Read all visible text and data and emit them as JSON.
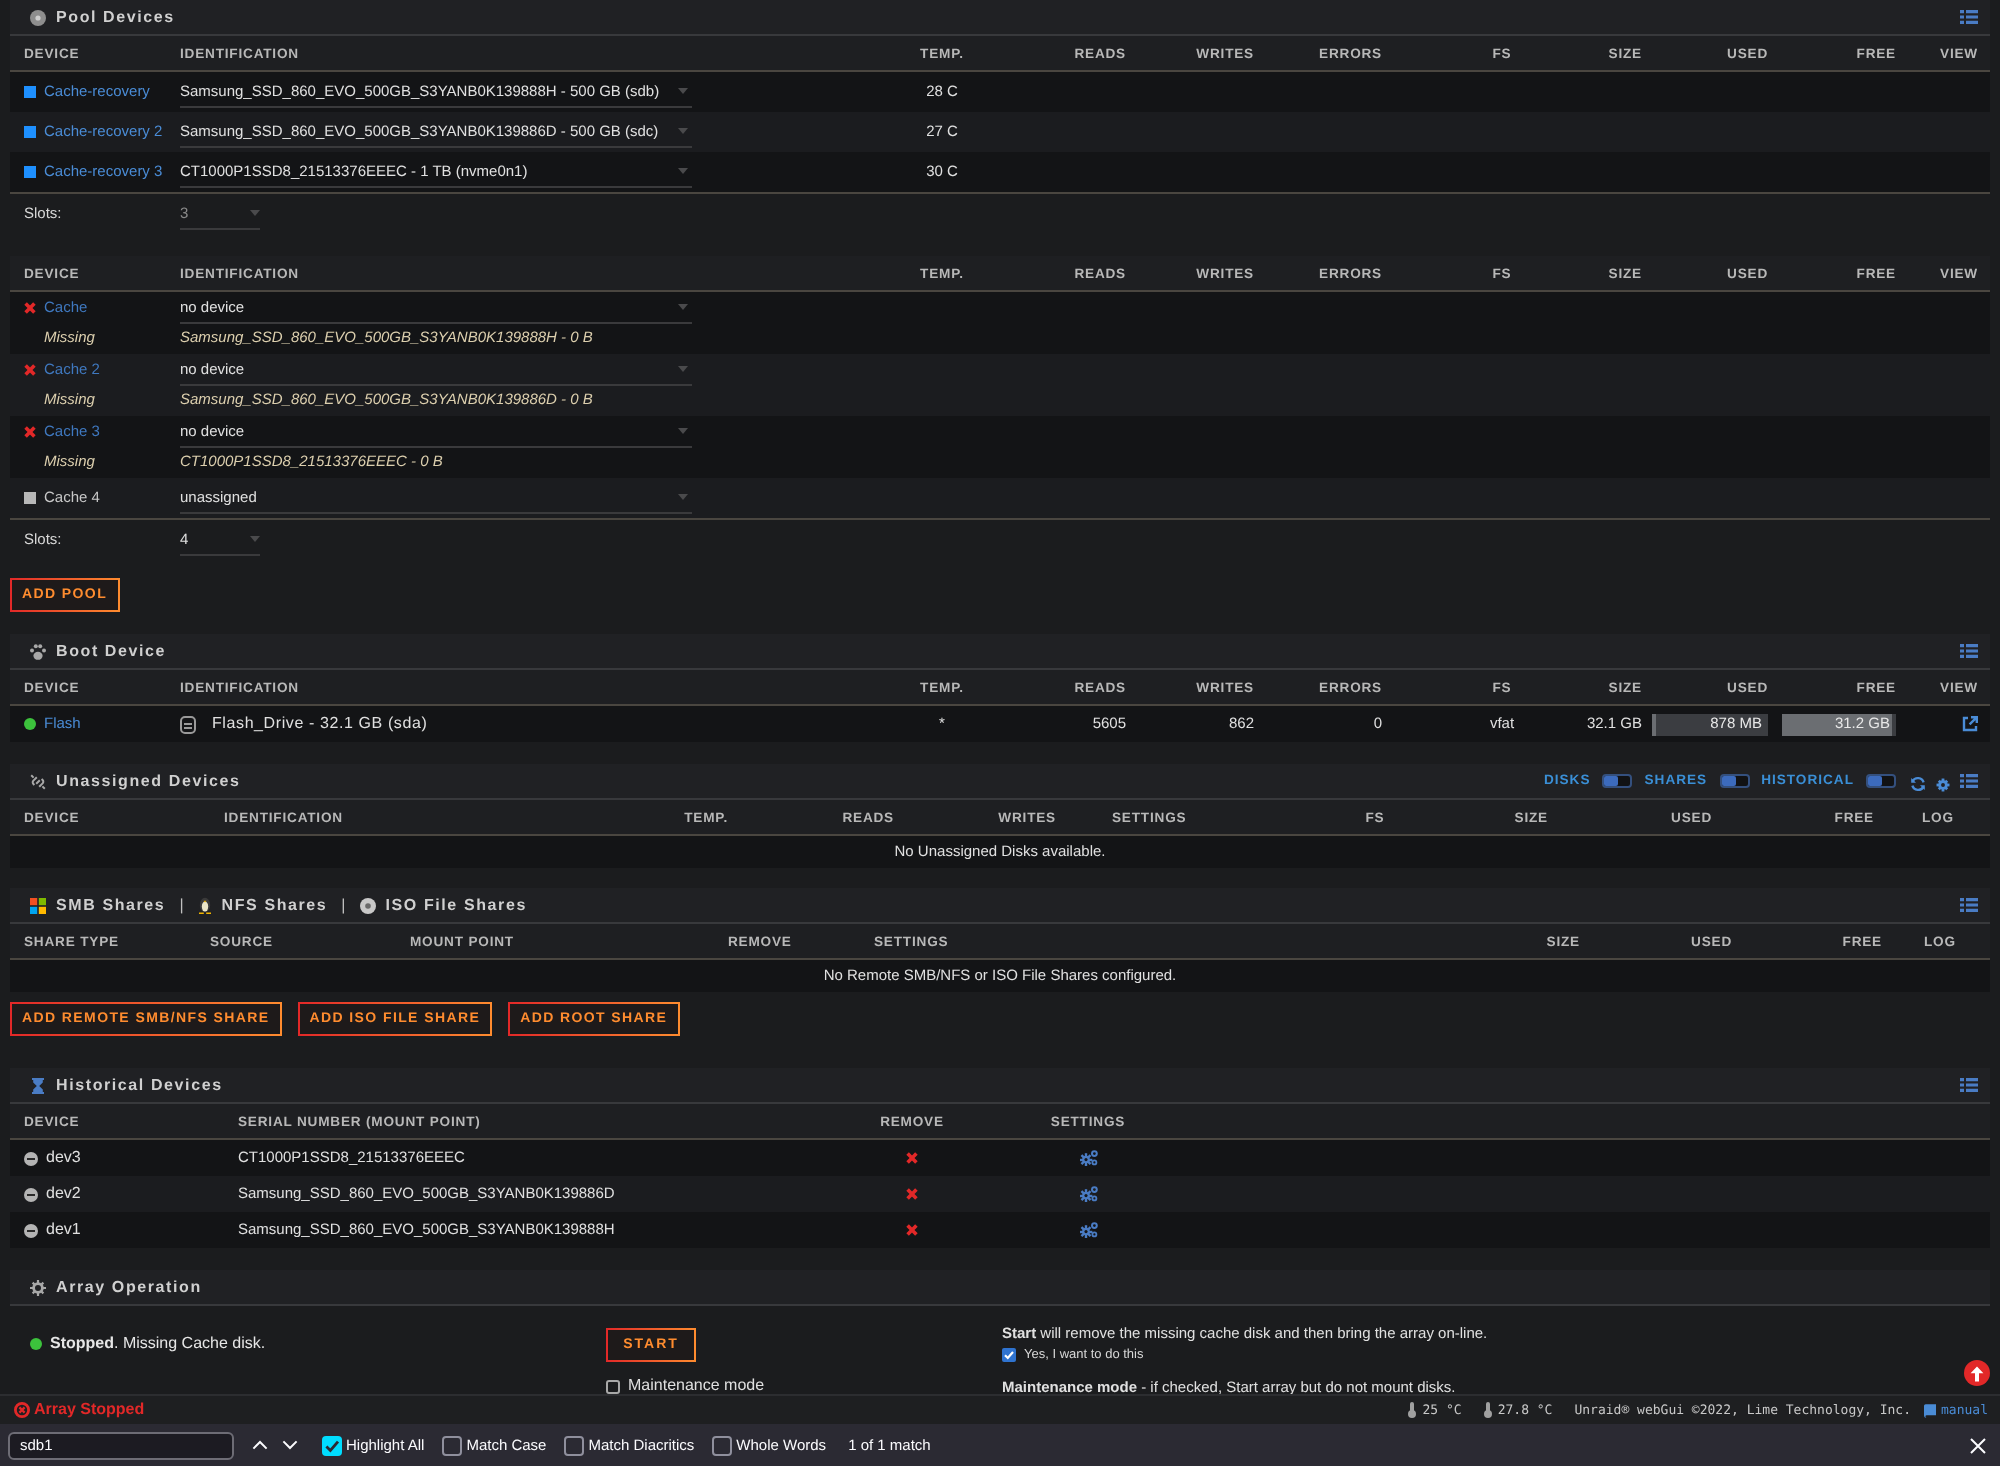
{
  "pool_devices": {
    "title": "Pool Devices",
    "pools": [
      {
        "columns": [
          "DEVICE",
          "IDENTIFICATION",
          "TEMP.",
          "READS",
          "WRITES",
          "ERRORS",
          "FS",
          "SIZE",
          "USED",
          "FREE",
          "VIEW"
        ],
        "rows": [
          {
            "kind": "online",
            "name": "Cache-recovery",
            "identification": "Samsung_SSD_860_EVO_500GB_S3YANB0K139888H - 500 GB (sdb)",
            "temp": "28 C"
          },
          {
            "kind": "online",
            "name": "Cache-recovery 2",
            "identification": "Samsung_SSD_860_EVO_500GB_S3YANB0K139886D - 500 GB (sdc)",
            "temp": "27 C"
          },
          {
            "kind": "online",
            "name": "Cache-recovery 3",
            "identification": "CT1000P1SSD8_21513376EEEC - 1 TB (nvme0n1)",
            "temp": "30 C"
          }
        ],
        "slots": {
          "label": "Slots:",
          "value": "3",
          "disabled": true
        }
      },
      {
        "columns": [
          "DEVICE",
          "IDENTIFICATION",
          "TEMP.",
          "READS",
          "WRITES",
          "ERRORS",
          "FS",
          "SIZE",
          "USED",
          "FREE",
          "VIEW"
        ],
        "rows": [
          {
            "kind": "missing",
            "name": "Cache",
            "note": "Missing",
            "identification": "no device",
            "previous": "Samsung_SSD_860_EVO_500GB_S3YANB0K139888H - 0 B"
          },
          {
            "kind": "missing",
            "name": "Cache 2",
            "note": "Missing",
            "identification": "no device",
            "previous": "Samsung_SSD_860_EVO_500GB_S3YANB0K139886D - 0 B"
          },
          {
            "kind": "missing",
            "name": "Cache 3",
            "note": "Missing",
            "identification": "no device",
            "previous": "CT1000P1SSD8_21513376EEEC - 0 B"
          },
          {
            "kind": "unassigned",
            "name": "Cache 4",
            "identification": "unassigned"
          }
        ],
        "slots": {
          "label": "Slots:",
          "value": "4",
          "disabled": false
        }
      }
    ],
    "add_pool_button": "ADD POOL"
  },
  "boot_device": {
    "title": "Boot Device",
    "columns": [
      "DEVICE",
      "IDENTIFICATION",
      "TEMP.",
      "READS",
      "WRITES",
      "ERRORS",
      "FS",
      "SIZE",
      "USED",
      "FREE",
      "VIEW"
    ],
    "rows": [
      {
        "kind": "ok",
        "name": "Flash",
        "identification": "Flash_Drive - 32.1 GB (sda)",
        "temp": "*",
        "reads": "5605",
        "writes": "862",
        "errors": "0",
        "fs": "vfat",
        "size": "32.1 GB",
        "used": {
          "text": "878 MB",
          "level": 0.03
        },
        "free": {
          "text": "31.2 GB",
          "level": 0.97
        }
      }
    ]
  },
  "unassigned_devices": {
    "title": "Unassigned Devices",
    "toggles": [
      {
        "label": "DISKS",
        "on": false
      },
      {
        "label": "SHARES",
        "on": false
      },
      {
        "label": "HISTORICAL",
        "on": false
      }
    ],
    "columns": [
      "DEVICE",
      "IDENTIFICATION",
      "TEMP.",
      "READS",
      "WRITES",
      "SETTINGS",
      "FS",
      "SIZE",
      "USED",
      "FREE",
      "LOG"
    ],
    "empty_message": "No Unassigned Disks available."
  },
  "remote_shares": {
    "titles": [
      {
        "kind": "smb",
        "text": "SMB Shares"
      },
      {
        "kind": "nfs",
        "text": "NFS Shares"
      },
      {
        "kind": "iso",
        "text": "ISO File Shares"
      }
    ],
    "separators": [
      "|",
      "|"
    ],
    "columns": [
      "SHARE TYPE",
      "SOURCE",
      "MOUNT POINT",
      "REMOVE",
      "SETTINGS",
      "SIZE",
      "USED",
      "FREE",
      "LOG"
    ],
    "empty_message": "No Remote SMB/NFS or ISO File Shares configured.",
    "buttons": [
      "ADD REMOTE SMB/NFS SHARE",
      "ADD ISO FILE SHARE",
      "ADD ROOT SHARE"
    ]
  },
  "historical_devices": {
    "title": "Historical Devices",
    "columns": [
      "DEVICE",
      "SERIAL NUMBER (MOUNT POINT)",
      "REMOVE",
      "SETTINGS"
    ],
    "rows": [
      {
        "device": "dev3",
        "serial": "CT1000P1SSD8_21513376EEEC"
      },
      {
        "device": "dev2",
        "serial": "Samsung_SSD_860_EVO_500GB_S3YANB0K139886D"
      },
      {
        "device": "dev1",
        "serial": "Samsung_SSD_860_EVO_500GB_S3YANB0K139888H"
      }
    ]
  },
  "array_operation": {
    "title": "Array Operation",
    "status_text": "**Stopped**. Missing Cache disk.",
    "start_button": "START",
    "start_note": "**Start** will remove the missing cache disk and then bring the array on-line.",
    "confirm": {
      "label": "Yes, I want to do this",
      "checked": true
    },
    "maintenance": {
      "label": "Maintenance mode",
      "checked": false
    },
    "maintenance_note": "**Maintenance mode** - if checked, Start array but do not mount disks."
  },
  "status_bar": {
    "array_status": "Array Stopped",
    "temperatures": [
      "25 °C",
      "27.8 °C"
    ],
    "copyright": "Unraid® webGui ©2022, Lime Technology, Inc.",
    "manual": "manual"
  },
  "find_bar": {
    "value": "sdb1",
    "options": [
      {
        "label": "Highlight All",
        "checked": true
      },
      {
        "label": "Match Case",
        "checked": false
      },
      {
        "label": "Match Diacritics",
        "checked": false
      },
      {
        "label": "Whole Words",
        "checked": false
      }
    ],
    "result": "1 of 1 match"
  }
}
